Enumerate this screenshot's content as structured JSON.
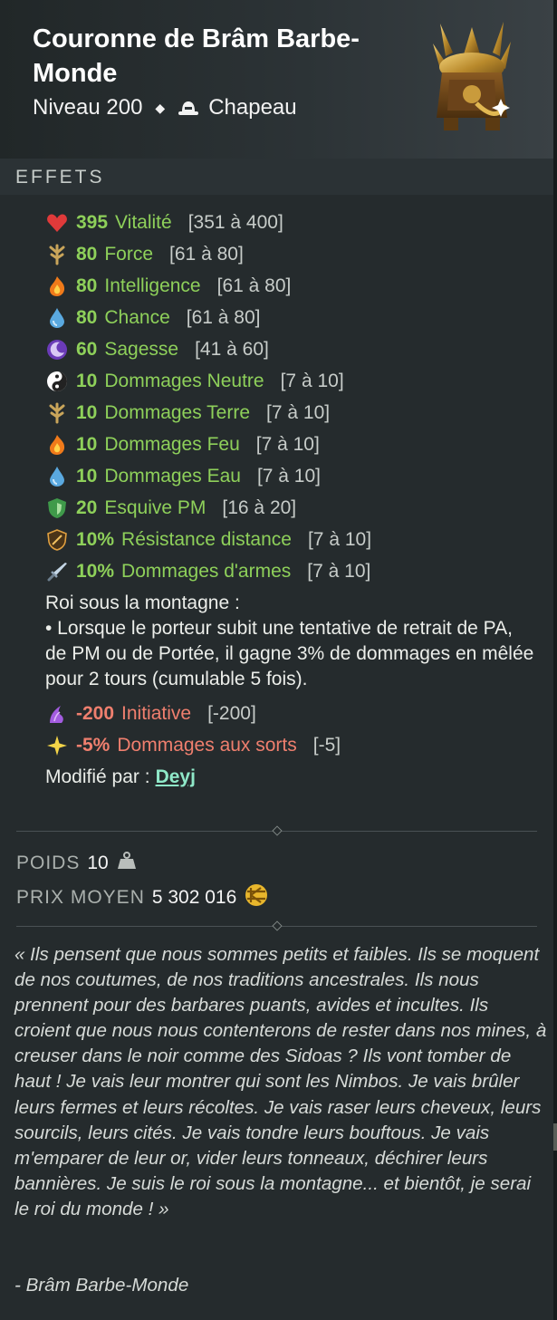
{
  "item": {
    "name": "Couronne de Brâm Barbe-Monde",
    "level": "Niveau 200",
    "type": "Chapeau"
  },
  "effects_header": "EFFETS",
  "effects": [
    {
      "icon": "heart-icon",
      "value": "395",
      "name": "Vitalité",
      "range": "[351 à 400]",
      "kind": "positive"
    },
    {
      "icon": "earth-icon",
      "value": "80",
      "name": "Force",
      "range": "[61 à 80]",
      "kind": "positive"
    },
    {
      "icon": "fire-icon",
      "value": "80",
      "name": "Intelligence",
      "range": "[61 à 80]",
      "kind": "positive"
    },
    {
      "icon": "water-icon",
      "value": "80",
      "name": "Chance",
      "range": "[61 à 80]",
      "kind": "positive"
    },
    {
      "icon": "wisdom-icon",
      "value": "60",
      "name": "Sagesse",
      "range": "[41 à 60]",
      "kind": "positive"
    },
    {
      "icon": "neutral-icon",
      "value": "10",
      "name": "Dommages Neutre",
      "range": "[7 à 10]",
      "kind": "positive"
    },
    {
      "icon": "earth-icon",
      "value": "10",
      "name": "Dommages Terre",
      "range": "[7 à 10]",
      "kind": "positive"
    },
    {
      "icon": "fire-icon",
      "value": "10",
      "name": "Dommages Feu",
      "range": "[7 à 10]",
      "kind": "positive"
    },
    {
      "icon": "water-icon",
      "value": "10",
      "name": "Dommages Eau",
      "range": "[7 à 10]",
      "kind": "positive"
    },
    {
      "icon": "dodge-icon",
      "value": "20",
      "name": "Esquive PM",
      "range": "[16 à 20]",
      "kind": "positive"
    },
    {
      "icon": "ranged-resistance-icon",
      "value": "10%",
      "name": "Résistance distance",
      "range": "[7 à 10]",
      "kind": "positive"
    },
    {
      "icon": "sword-icon",
      "value": "10%",
      "name": "Dommages d'armes",
      "range": "[7 à 10]",
      "kind": "positive"
    }
  ],
  "set_bonus": {
    "title": "Roi sous la montagne :",
    "text": "• Lorsque le porteur subit une tentative de retrait de PA, de PM ou de Portée, il gagne 3% de dommages en mêlée pour 2 tours (cumulable 5 fois)."
  },
  "negative_effects": [
    {
      "icon": "initiative-icon",
      "value": "-200",
      "name": "Initiative",
      "range": "[-200]",
      "kind": "negative"
    },
    {
      "icon": "spell-damage-icon",
      "value": "-5%",
      "name": "Dommages aux sorts",
      "range": "[-5]",
      "kind": "negative"
    }
  ],
  "modified_by": {
    "label": "Modifié par :",
    "name": "Deyj"
  },
  "weight": {
    "label": "POIDS",
    "value": "10"
  },
  "price": {
    "label": "PRIX MOYEN",
    "value": "5 302 016"
  },
  "lore": "« Ils pensent que nous sommes petits et faibles. Ils se moquent de nos coutumes, de nos traditions ancestrales. Ils nous prennent pour des barbares puants, avides et incultes. Ils croient que nous nous contenterons de rester dans nos mines, à creuser dans le noir comme des Sidoas ? Ils vont tomber de haut ! Je vais leur montrer qui sont les Nimbos. Je vais brûler leurs fermes et leurs récoltes. Je vais raser leurs cheveux, leurs sourcils, leurs cités. Je vais tondre leurs bouftous. Je vais m'emparer de leur or, vider leurs tonneaux, déchirer leurs bannières. Je suis le roi sous la montagne... et bientôt, je serai le roi du monde ! »",
  "lore_author": "- Brâm Barbe-Monde",
  "colors": {
    "positive": "#8ed05a",
    "negative": "#ef7f6e",
    "link": "#8fe8c8"
  }
}
